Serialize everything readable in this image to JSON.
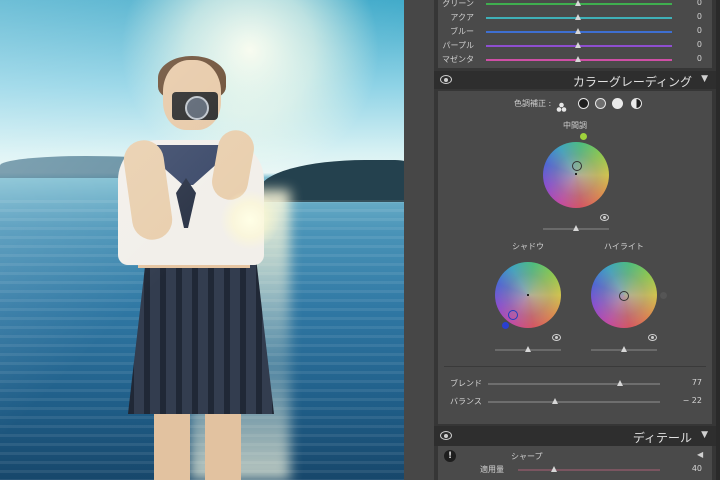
{
  "hsl_saturation": {
    "rows": [
      {
        "label": "グリーン",
        "value": "0",
        "color": "#3fae4f"
      },
      {
        "label": "アクア",
        "value": "0",
        "color": "#3fb0b8"
      },
      {
        "label": "ブルー",
        "value": "0",
        "color": "#3e6fd1"
      },
      {
        "label": "パープル",
        "value": "0",
        "color": "#8e4fd0"
      },
      {
        "label": "マゼンタ",
        "value": "0",
        "color": "#cf4fa6"
      }
    ]
  },
  "color_grading": {
    "title": "カラーグレーディング",
    "adjust_label": "色調補正 :",
    "modes": [
      "three-way-icon",
      "shadows-icon",
      "midtones-icon",
      "highlights-icon",
      "global-icon"
    ],
    "midtones": {
      "label": "中間調",
      "swatch": "#9fd23c"
    },
    "shadows": {
      "label": "シャドウ",
      "swatch": "#2a3fcf"
    },
    "highlights": {
      "label": "ハイライト",
      "swatch": "#555555"
    },
    "blend": {
      "label": "ブレンド",
      "value": "77",
      "fraction": 0.77
    },
    "balance": {
      "label": "バランス",
      "value": "− 22",
      "fraction": 0.39
    }
  },
  "detail": {
    "title": "ディテール",
    "sharpen": {
      "label": "シャープ",
      "amount_label": "適用量",
      "amount_value": "40"
    }
  }
}
